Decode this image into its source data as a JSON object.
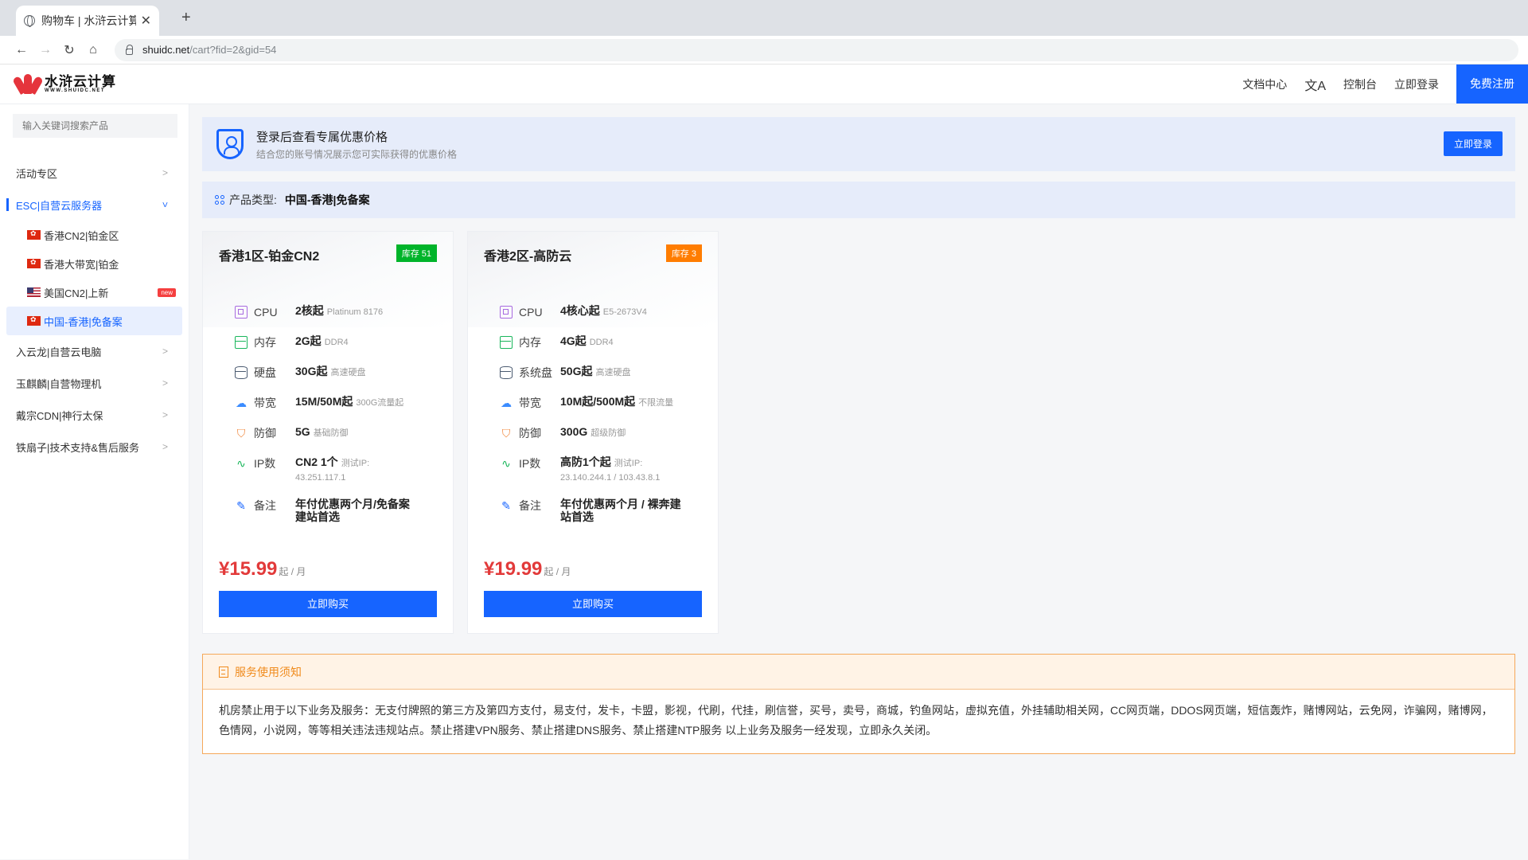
{
  "browser": {
    "tab_title": "购物车 | 水浒云计算",
    "url_host": "shuidc.net",
    "url_path": "/cart?fid=2&gid=54"
  },
  "header": {
    "logo_cn": "水浒云计算",
    "logo_en": "WWW.SHUIDC.NET",
    "nav": [
      "文档中心",
      "控制台",
      "立即登录"
    ],
    "register": "免费注册"
  },
  "sidebar": {
    "search_placeholder": "输入关键词搜索产品",
    "menu": [
      {
        "label": "活动专区"
      },
      {
        "label": "ESC|自营云服务器"
      },
      {
        "label": "入云龙|自营云电脑"
      },
      {
        "label": "玉麒麟|自营物理机"
      },
      {
        "label": "戴宗CDN|神行太保"
      },
      {
        "label": "铁扇子|技术支持&售后服务"
      }
    ],
    "sub": [
      {
        "label": "香港CN2|铂金区"
      },
      {
        "label": "香港大带宽|铂金"
      },
      {
        "label": "美国CN2|上新",
        "badge": "new"
      },
      {
        "label": "中国-香港|免备案"
      }
    ]
  },
  "login_notice": {
    "title": "登录后查看专属优惠价格",
    "subtitle": "结合您的账号情况展示您可实际获得的优惠价格",
    "button": "立即登录"
  },
  "product_type": {
    "label": "产品类型:",
    "value": "中国-香港|免备案"
  },
  "cards": [
    {
      "title": "香港1区-铂金CN2",
      "stock": "库存 51",
      "specs": {
        "cpu": {
          "k": "CPU",
          "v": "2核起",
          "sub": "Platinum 8176"
        },
        "mem": {
          "k": "内存",
          "v": "2G起",
          "sub": "DDR4"
        },
        "disk": {
          "k": "硬盘",
          "v": "30G起",
          "sub": "高速硬盘"
        },
        "bw": {
          "k": "带宽",
          "v": "15M/50M起",
          "sub": "300G流量起"
        },
        "def": {
          "k": "防御",
          "v": "5G",
          "sub": "基础防御"
        },
        "ip": {
          "k": "IP数",
          "v": "CN2 1个",
          "sub": "测试IP:",
          "sub2": "43.251.117.1"
        },
        "note": {
          "k": "备注",
          "v": "年付优惠两个月/免备案建站首选"
        }
      },
      "price": "¥15.99",
      "unit": "起 / 月",
      "buy": "立即购买"
    },
    {
      "title": "香港2区-高防云",
      "stock": "库存 3",
      "specs": {
        "cpu": {
          "k": "CPU",
          "v": "4核心起",
          "sub": "E5-2673V4"
        },
        "mem": {
          "k": "内存",
          "v": "4G起",
          "sub": "DDR4"
        },
        "disk": {
          "k": "系统盘",
          "v": "50G起",
          "sub": "高速硬盘"
        },
        "bw": {
          "k": "带宽",
          "v": "10M起/500M起",
          "sub": "不限流量"
        },
        "def": {
          "k": "防御",
          "v": "300G",
          "sub": "超级防御"
        },
        "ip": {
          "k": "IP数",
          "v": "高防1个起",
          "sub": "测试IP:",
          "sub2": "23.140.244.1 / 103.43.8.1"
        },
        "note": {
          "k": "备注",
          "v": "年付优惠两个月 / 裸奔建站首选"
        }
      },
      "price": "¥19.99",
      "unit": "起 / 月",
      "buy": "立即购买"
    }
  ],
  "tos": {
    "title": "服务使用须知",
    "body": "机房禁止用于以下业务及服务：无支付牌照的第三方及第四方支付，易支付，发卡，卡盟，影视，代刷，代挂，刷信誉，买号，卖号，商城，钓鱼网站，虚拟充值，外挂辅助相关网，CC网页端，DDOS网页端，短信轰炸，赌博网站，云免网，诈骗网，赌博网，色情网，小说网，等等相关违法违规站点。禁止搭建VPN服务、禁止搭建DNS服务、禁止搭建NTP服务 以上业务及服务一经发现，立即永久关闭。"
  },
  "colors": {
    "accent": "#1664ff",
    "price": "#e23a3a",
    "stock_green": "#00b42a",
    "stock_orange": "#ff7d00",
    "warning": "#f08b1d"
  }
}
